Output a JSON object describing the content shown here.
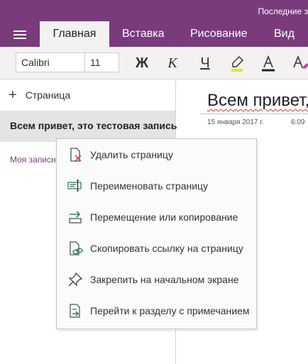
{
  "titlebar": {
    "recent_label": "Последние з"
  },
  "ribbon": {
    "tabs": [
      {
        "label": "Главная",
        "active": true
      },
      {
        "label": "Вставка"
      },
      {
        "label": "Рисование"
      },
      {
        "label": "Вид"
      }
    ]
  },
  "toolbar": {
    "font_name": "Calibri",
    "font_size": "11",
    "bold_label": "Ж",
    "italic_label": "К",
    "underline_label": "Ч",
    "highlight_color": "#e8e800",
    "font_color": "#222222"
  },
  "pages_pane": {
    "add_page_label": "Страница",
    "pages": [
      {
        "title": "Всем привет, это тестовая запись"
      }
    ],
    "section_label": "Моя записн"
  },
  "note": {
    "title": "Всем привет,",
    "date": "15 января 2017 г.",
    "time": "6:09"
  },
  "context_menu": {
    "items": [
      {
        "label": "Удалить страницу",
        "icon": "delete-page-icon"
      },
      {
        "label": "Переименовать страницу",
        "icon": "rename-page-icon"
      },
      {
        "label": "Перемещение или копирование",
        "icon": "move-copy-icon"
      },
      {
        "label": "Скопировать ссылку на страницу",
        "icon": "copy-link-icon"
      },
      {
        "label": "Закрепить на начальном экране",
        "icon": "pin-icon"
      },
      {
        "label": "Перейти к разделу с примечанием",
        "icon": "go-to-section-icon"
      }
    ]
  },
  "colors": {
    "accent": "#7a3b7d",
    "ribbon_bg": "#f3f2f1",
    "selected_row": "#e6e4e3"
  }
}
